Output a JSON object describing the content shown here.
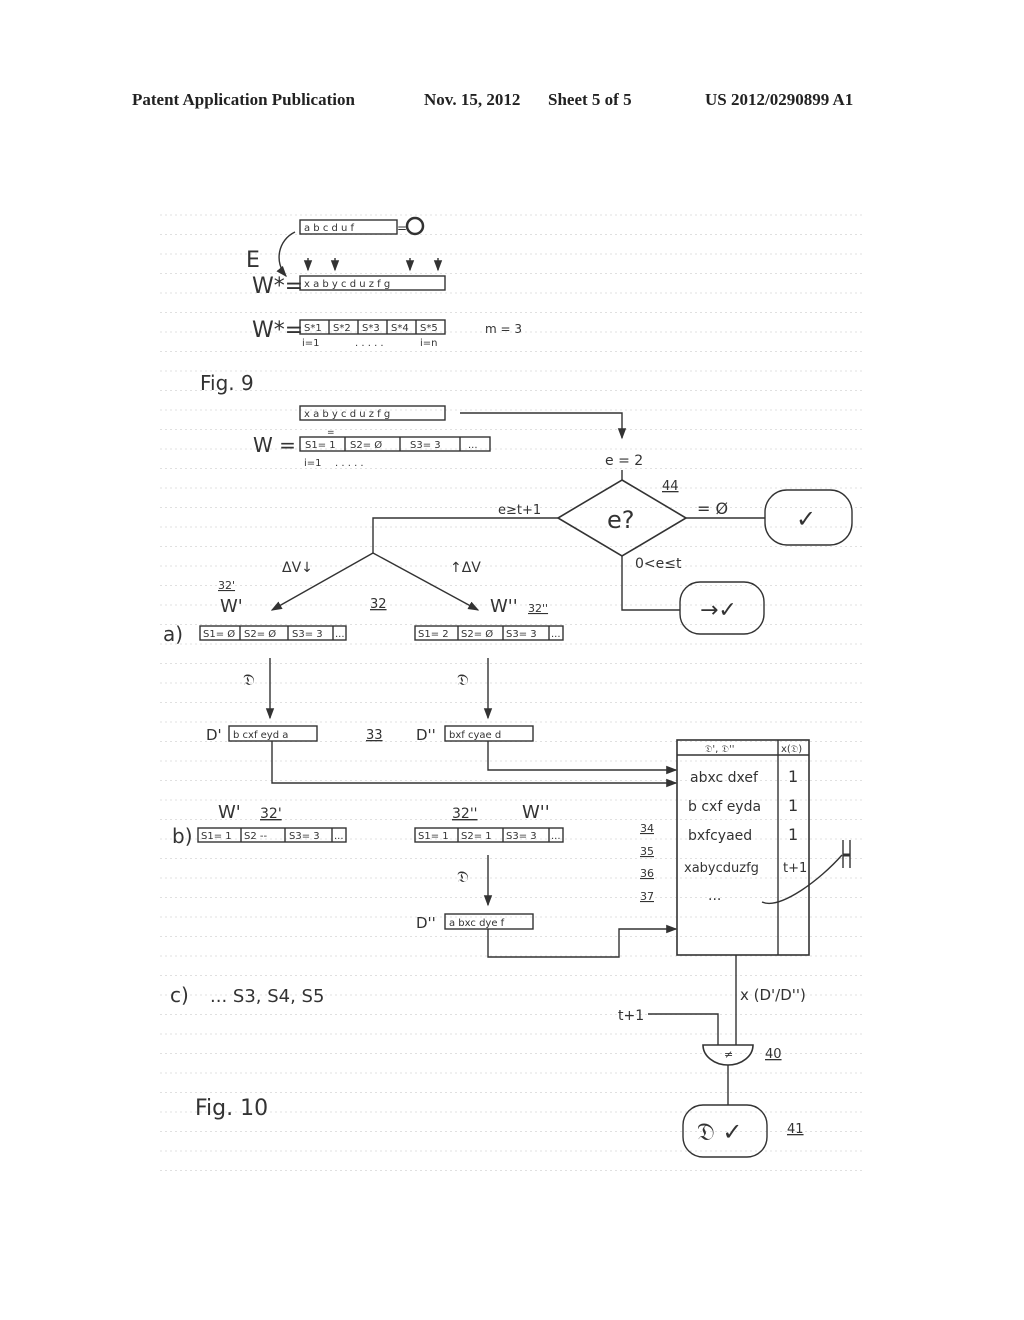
{
  "header": {
    "left": "Patent Application Publication",
    "date": "Nov. 15, 2012",
    "sheet": "Sheet 5 of 5",
    "number": "US 2012/0290899 A1"
  },
  "fig9": {
    "label": "Fig. 9",
    "top_word": "a b c d u f",
    "top_word_eq": "= O",
    "E_label": "E",
    "wstar1_label": "W*=",
    "wstar1_word": "x a b y c d u z f g",
    "wstar2_label": "W*=",
    "wstar2_cells": [
      "S*1",
      "S*2",
      "S*3",
      "S*4",
      "S*5"
    ],
    "index_start": "i=1",
    "index_dots": ". . . . .",
    "index_end": "i=n",
    "m_label": "m = 3"
  },
  "fig10": {
    "label": "Fig. 10",
    "input_word": "x a b y c d u z f g",
    "equiv": "=",
    "w_label": "W =",
    "w_cells": [
      "S1= 1",
      "S2= Ø",
      "S3= 3",
      "..."
    ],
    "w_index": "i=1",
    "w_index_dots": ". . . . .",
    "e_eq": "e = 2",
    "decision_label": "e?",
    "ref_44": "44",
    "branch_zero": "= Ø",
    "branch_high": "e≥t+1",
    "branch_mid": "0<e≤t",
    "ok_terminal": "✓",
    "correctable_terminal": "→✓",
    "delta_down": "ΔV↓",
    "delta_up": "↑ΔV",
    "ref_32": "32",
    "row_a": {
      "label": "a)",
      "left_ref": "32'",
      "left_w": "W'",
      "left_cells": [
        "S1= Ø",
        "S2= Ø",
        "S3= 3",
        "..."
      ],
      "right_w": "W''",
      "right_ref": "32''",
      "right_cells": [
        "S1= 2",
        "S2= Ø",
        "S3= 3",
        "..."
      ],
      "decode_left": "𝔇",
      "decode_right": "𝔇",
      "d_left_label": "D'",
      "d_left_word": "b cxf eyd a",
      "ref_33": "33",
      "d_right_label": "D''",
      "d_right_word": "bxf cyae d"
    },
    "row_b": {
      "label": "b)",
      "left_w": "W'",
      "left_ref": "32'",
      "left_cells": [
        "S1= 1",
        "S2 --",
        "S3= 3",
        "..."
      ],
      "right_ref": "32''",
      "right_w": "W''",
      "right_cells": [
        "S1= 1",
        "S2= 1",
        "S3= 3",
        "..."
      ],
      "decode": "𝔇",
      "d_label": "D''",
      "d_word": "a bxc dye f"
    },
    "row_c": {
      "label": "c)",
      "text": "... S3, S4, S5"
    },
    "table": {
      "header_left": "𝔇', 𝔇''",
      "header_right": "x(𝔇)",
      "rows": [
        {
          "word": "abxc dxef",
          "count": "1",
          "ref": "34"
        },
        {
          "word": "b cxf eyda",
          "count": "1",
          "ref": "35"
        },
        {
          "word": "bxfcyaed",
          "count": "1",
          "ref": "36"
        },
        {
          "word": "xabycduzfg",
          "count": "t+1",
          "ref": "37"
        },
        {
          "word": "...",
          "count": "",
          "ref": ""
        }
      ],
      "h_label": "H"
    },
    "x_label": "x (D'/D'')",
    "threshold_label": "t+1",
    "comparator_symbol": "≠",
    "ref_40": "40",
    "result_terminal": "𝔇 ✓",
    "ref_41": "41"
  }
}
